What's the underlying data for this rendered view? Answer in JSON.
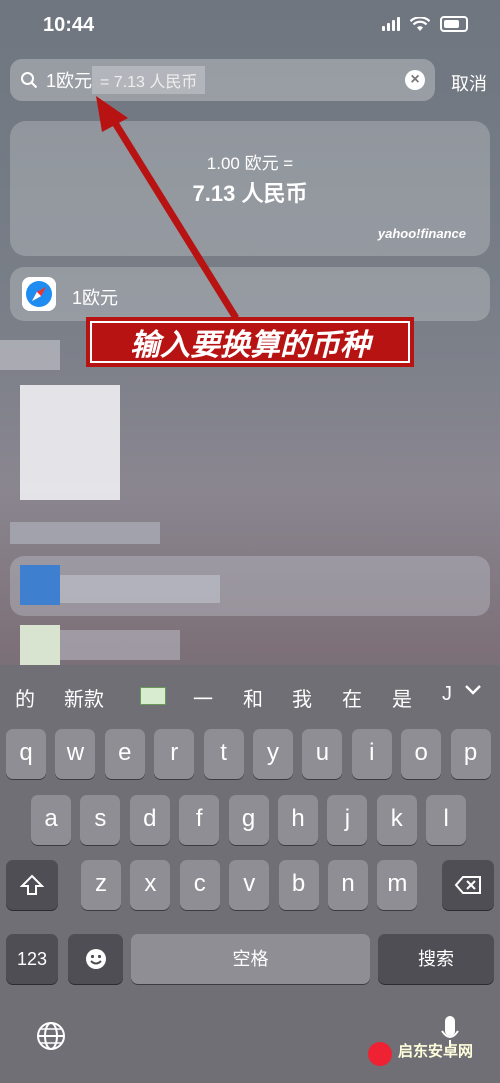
{
  "status": {
    "time": "10:44"
  },
  "search": {
    "query": "1欧元",
    "hint": "= 7.13 人民币",
    "cancel_label": "取消"
  },
  "conversion": {
    "from": "1.00 欧元 =",
    "to": "7.13 人民币",
    "provider": "yahoo!finance"
  },
  "suggestion": {
    "label": "1欧元",
    "icon": "safari-icon"
  },
  "annotation": {
    "text": "输入要换算的币种",
    "color": "#b81313"
  },
  "keyboard": {
    "candidates": [
      "的",
      "新款",
      "一",
      "和",
      "我",
      "在",
      "是",
      "J"
    ],
    "row1": [
      "q",
      "w",
      "e",
      "r",
      "t",
      "y",
      "u",
      "i",
      "o",
      "p"
    ],
    "row2": [
      "a",
      "s",
      "d",
      "f",
      "g",
      "h",
      "j",
      "k",
      "l"
    ],
    "row3": [
      "z",
      "x",
      "c",
      "v",
      "b",
      "n",
      "m"
    ],
    "numbers_label": "123",
    "space_label": "空格",
    "search_label": "搜索"
  },
  "watermark": {
    "text": "启东安卓网"
  }
}
